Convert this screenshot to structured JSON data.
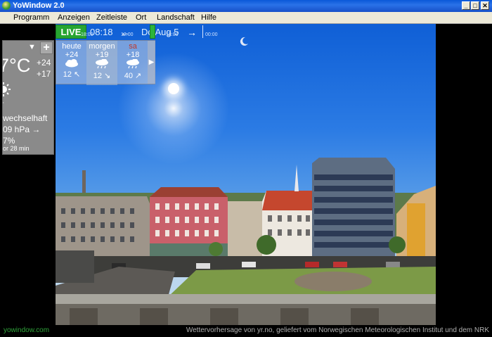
{
  "window": {
    "title": "YoWindow 2.0",
    "min_label": "_",
    "max_label": "□",
    "close_label": "✕"
  },
  "menu": {
    "items": [
      "Programm",
      "Anzeigen",
      "Zeitleiste",
      "Ort",
      "Landschaft",
      "Hilfe"
    ]
  },
  "timeline": {
    "live_label": "LIVE",
    "clock": "08:18",
    "date": "Do Aug 5",
    "prev_label": "←",
    "next_label": "→",
    "ticks": [
      "18:00",
      "12:00",
      "18:00",
      "00:00"
    ]
  },
  "current": {
    "temp": "7°C",
    "high": "+24",
    "low": "+17",
    "condition": "wechselhaft",
    "pressure": "09 hPa →",
    "humidity": "7%",
    "updated": "or 28 min",
    "plus_label": "+",
    "dropdown_label": "▼"
  },
  "forecast": {
    "days": [
      {
        "name": "heute",
        "temp": "+24",
        "wind": "12",
        "wind_dir": "↖"
      },
      {
        "name": "morgen",
        "temp": "+19",
        "wind": "12",
        "wind_dir": "↘"
      },
      {
        "name": "sa",
        "temp": "+18",
        "wind": "40",
        "wind_dir": "↗"
      }
    ],
    "more_label": "▶",
    "saturday_color": "#c0392b"
  },
  "footer": {
    "brand": "yowindow.com",
    "credits": "Wettervorhersage von yr.no, geliefert vom Norwegischen Meteorologischen Institut und dem NRK"
  }
}
